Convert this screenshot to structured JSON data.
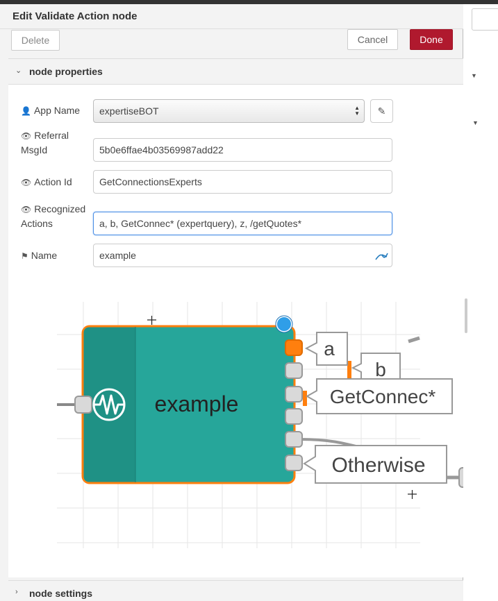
{
  "dialog": {
    "title": "Edit Validate Action node",
    "delete_label": "Delete",
    "cancel_label": "Cancel",
    "done_label": "Done"
  },
  "sections": {
    "properties": "node properties",
    "settings": "node settings"
  },
  "form": {
    "app_name": {
      "label": "App Name",
      "value": "expertiseBOT"
    },
    "referral_msgid": {
      "label_line1": "Referral",
      "label_line2": "MsgId",
      "value": "5b0e6ffae4b03569987add22"
    },
    "action_id": {
      "label": "Action Id",
      "value": "GetConnectionsExperts"
    },
    "recognized_actions": {
      "label_line1": "Recognized",
      "label_line2": "Actions",
      "value": "a, b, GetConnec* (expertquery), z, /getQuotes*"
    },
    "name": {
      "label": "Name",
      "value": "example"
    }
  },
  "node_preview": {
    "node_label": "example",
    "output_labels": [
      "a",
      "b",
      "GetConnec*",
      "Otherwise"
    ],
    "colors": {
      "node": "#26a69a",
      "node_dark": "#1f9185",
      "selected_border": "#ff7f0e",
      "port": "#d9d9d9",
      "port_active": "#ff7f0e"
    }
  },
  "icons": {
    "user": "user-icon",
    "eye": "eye-icon",
    "tag": "tag-icon",
    "pencil": "pencil-icon",
    "expand": "expand-icon",
    "chevron_down": "chevron-down-icon",
    "chevron_right": "chevron-right-icon"
  },
  "colors": {
    "done_button": "#b0192e",
    "focus_border": "#4a8ee6"
  }
}
